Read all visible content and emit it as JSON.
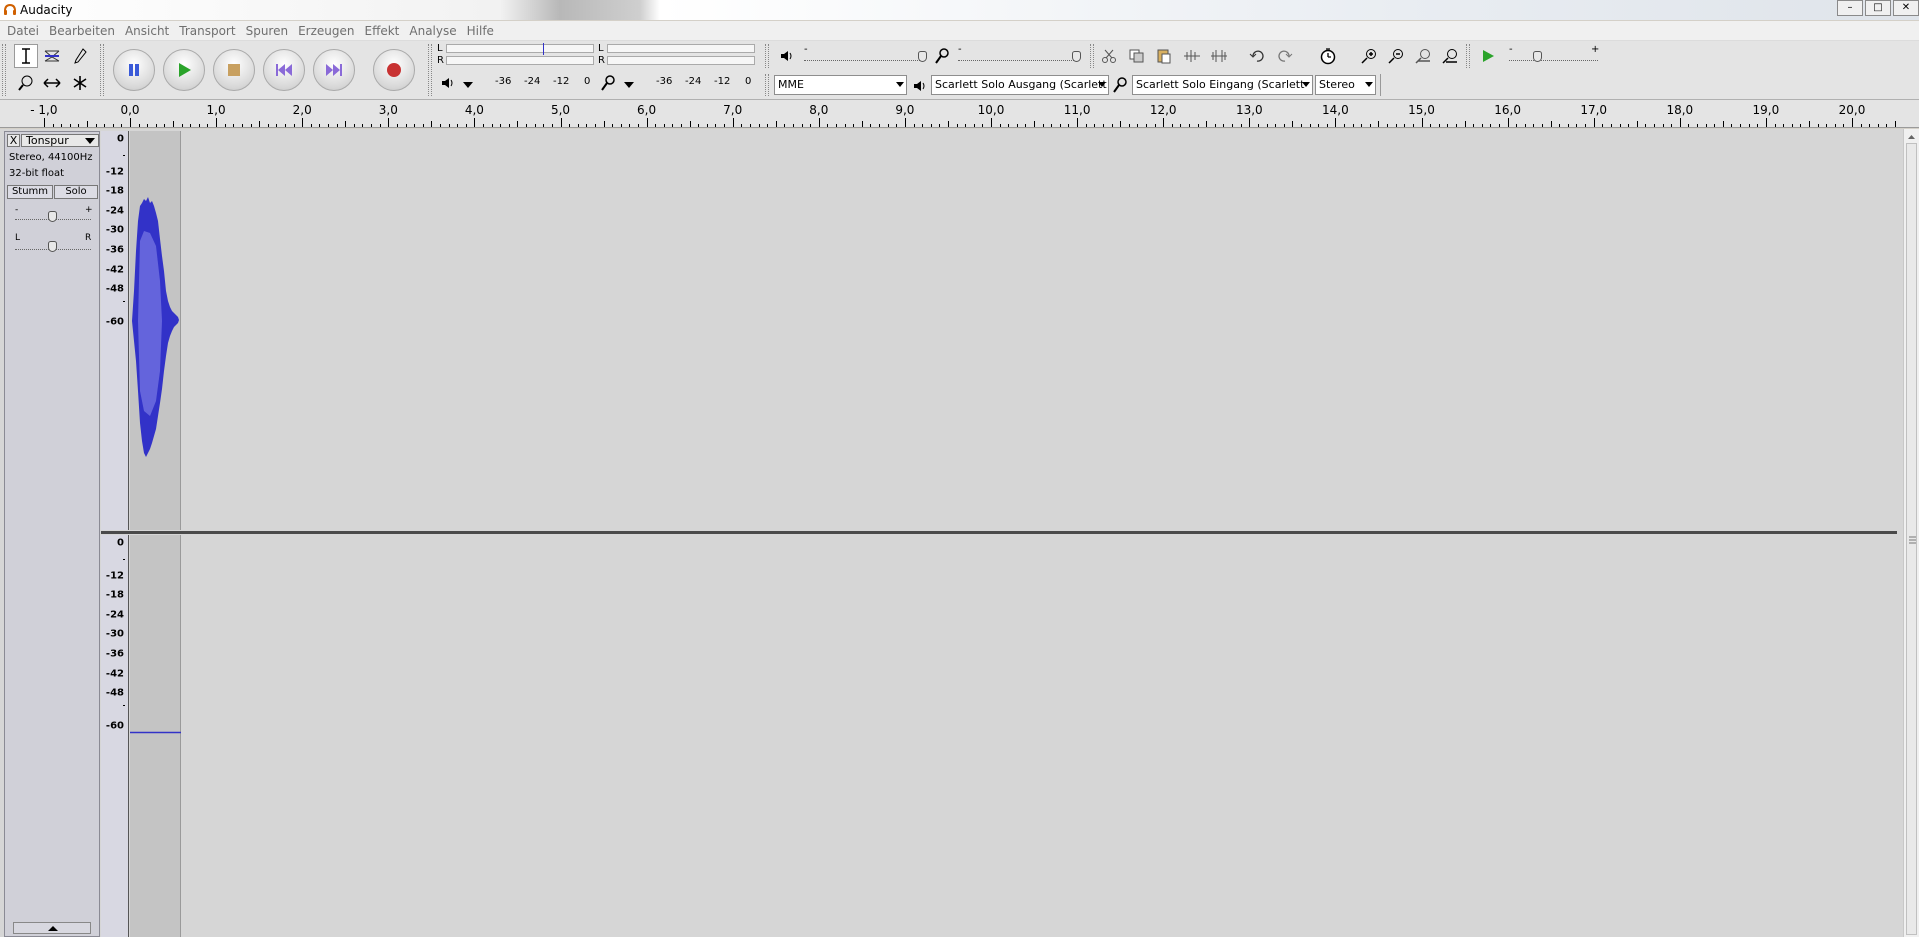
{
  "window": {
    "title": "Audacity",
    "controls": {
      "minimize": "–",
      "maximize": "□",
      "close": "✕"
    }
  },
  "menu": [
    "Datei",
    "Bearbeiten",
    "Ansicht",
    "Transport",
    "Spuren",
    "Erzeugen",
    "Effekt",
    "Analyse",
    "Hilfe"
  ],
  "meters": {
    "left_label": "L",
    "right_label": "R",
    "scale": [
      "-36",
      "-24",
      "-12",
      "0"
    ]
  },
  "devices": {
    "host": "MME",
    "output": "Scarlett Solo Ausgang (Scarlett",
    "input": "Scarlett Solo Eingang (Scarlett",
    "channels": "Stereo"
  },
  "ruler": {
    "labels": [
      "- 1,0",
      "0,0",
      "1,0",
      "2,0",
      "3,0",
      "4,0",
      "5,0",
      "6,0",
      "7,0",
      "8,0",
      "9,0",
      "10,0",
      "11,0",
      "12,0",
      "13,0",
      "14,0",
      "15,0",
      "16,0",
      "17,0",
      "18,0",
      "19,0",
      "20,0"
    ]
  },
  "track": {
    "close_label": "X",
    "name": "Tonspur",
    "format": "Stereo, 44100Hz",
    "bit_depth": "32-bit float",
    "mute_label": "Stumm",
    "solo_label": "Solo",
    "gain_minus": "-",
    "gain_plus": "+",
    "pan_left": "L",
    "pan_right": "R",
    "db_scale": [
      "0",
      "-12",
      "-18",
      "-24",
      "-30",
      "-36",
      "-42",
      "-48",
      "-60"
    ]
  },
  "sliders": {
    "playback_minus": "-",
    "playback_plus": "+",
    "speed_minus": "-",
    "speed_plus": "+"
  },
  "colors": {
    "waveform": "#3232c8",
    "waveform_light": "#6464dc",
    "play_green": "#2aa32a",
    "record_red": "#c83232"
  }
}
